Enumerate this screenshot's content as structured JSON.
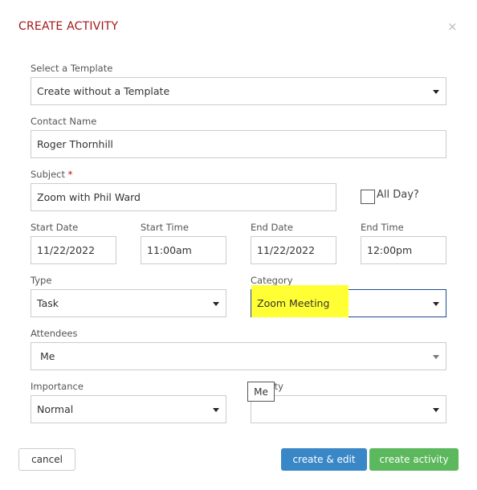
{
  "dialog": {
    "title": "CREATE ACTIVITY",
    "close_icon": "×"
  },
  "template": {
    "label": "Select a Template",
    "value": "Create without a Template"
  },
  "contact": {
    "label": "Contact Name",
    "value": "Roger Thornhill"
  },
  "subject": {
    "label": "Subject",
    "required": "*",
    "value": "Zoom with Phil Ward"
  },
  "all_day": {
    "label": "All Day?",
    "checked": false
  },
  "start_date": {
    "label": "Start Date",
    "value": "11/22/2022"
  },
  "start_time": {
    "label": "Start Time",
    "value": "11:00am"
  },
  "end_date": {
    "label": "End Date",
    "value": "11/22/2022"
  },
  "end_time": {
    "label": "End Time",
    "value": "12:00pm"
  },
  "type": {
    "label": "Type",
    "value": "Task"
  },
  "category": {
    "label": "Category",
    "value": "Zoom Meeting",
    "highlight": "#ffff33"
  },
  "attendees": {
    "label": "Attendees",
    "value": "Me"
  },
  "importance": {
    "label": "Importance",
    "value": "Normal"
  },
  "priority": {
    "label": "Priority",
    "value": ""
  },
  "tooltip": {
    "text": "Me"
  },
  "buttons": {
    "cancel": "cancel",
    "create_edit": "create & edit",
    "create": "create activity"
  },
  "colors": {
    "title": "#a31515",
    "create_edit": "#3a87c8",
    "create": "#5cb85c"
  }
}
